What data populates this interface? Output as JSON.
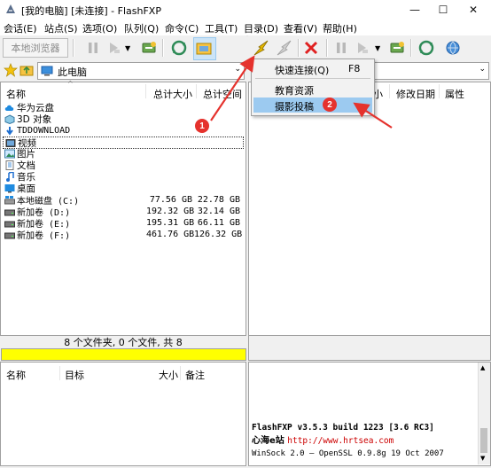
{
  "window": {
    "title": "[我的电脑]  [未连接] - FlashFXP",
    "minimize_glyph": "—",
    "maximize_glyph": "☐",
    "close_glyph": "✕"
  },
  "menu": [
    "会话(E)",
    "站点(S)",
    "选项(O)",
    "队列(Q)",
    "命令(C)",
    "工具(T)",
    "目录(D)",
    "查看(V)",
    "帮助(H)"
  ],
  "left_toolbar": {
    "browse_label": "本地浏览器"
  },
  "left_address": {
    "path": "此电脑"
  },
  "left_panel": {
    "columns": [
      "名称",
      "总计大小",
      "总计空间"
    ],
    "items": [
      {
        "name": "华为云盘",
        "icon": "cloud-icon",
        "total": "",
        "free": ""
      },
      {
        "name": "3D 对象",
        "icon": "cube-icon",
        "total": "",
        "free": ""
      },
      {
        "name": "TDDOWNLOAD",
        "icon": "download-icon",
        "total": "",
        "free": ""
      },
      {
        "name": "视频",
        "icon": "video-icon",
        "total": "",
        "free": ""
      },
      {
        "name": "图片",
        "icon": "picture-icon",
        "total": "",
        "free": ""
      },
      {
        "name": "文档",
        "icon": "document-icon",
        "total": "",
        "free": ""
      },
      {
        "name": "音乐",
        "icon": "music-icon",
        "total": "",
        "free": ""
      },
      {
        "name": "桌面",
        "icon": "desktop-icon",
        "total": "",
        "free": ""
      },
      {
        "name": "本地磁盘 (C:)",
        "icon": "system-drive-icon",
        "total": "77.56 GB",
        "free": "22.78 GB"
      },
      {
        "name": "新加卷 (D:)",
        "icon": "drive-icon",
        "total": "192.32 GB",
        "free": "32.14 GB"
      },
      {
        "name": "新加卷 (E:)",
        "icon": "drive-icon",
        "total": "195.31 GB",
        "free": "66.11 GB"
      },
      {
        "name": "新加卷 (F:)",
        "icon": "drive-icon",
        "total": "461.76 GB",
        "free": "126.32 GB"
      }
    ],
    "status": "8 个文件夹, 0 个文件, 共 8"
  },
  "right_panel": {
    "columns_visible": [
      "小",
      "修改日期",
      "属性"
    ]
  },
  "dropdown": {
    "items": [
      {
        "label": "快速连接(Q)",
        "shortcut": "F8"
      },
      {
        "label": "教育资源",
        "shortcut": ""
      },
      {
        "label": "摄影投稿",
        "shortcut": "",
        "highlighted": true
      }
    ]
  },
  "annotations": {
    "badge1": "1",
    "badge2": "2",
    "color": "#e5322d"
  },
  "queue": {
    "columns": [
      "名称",
      "目标",
      "大小",
      "备注"
    ]
  },
  "log": {
    "line1": "FlashFXP v3.5.3 build 1223 [3.6 RC3]",
    "line2_prefix": "心海e站 ",
    "line2_url": "http://www.hrtsea.com",
    "line3": "WinSock 2.0 — OpenSSL 0.9.8g 19 Oct 2007"
  },
  "colors": {
    "highlight": "#9ccaf0",
    "progress": "#ffff00",
    "link": "#cc0000",
    "badge": "#e5322d"
  }
}
